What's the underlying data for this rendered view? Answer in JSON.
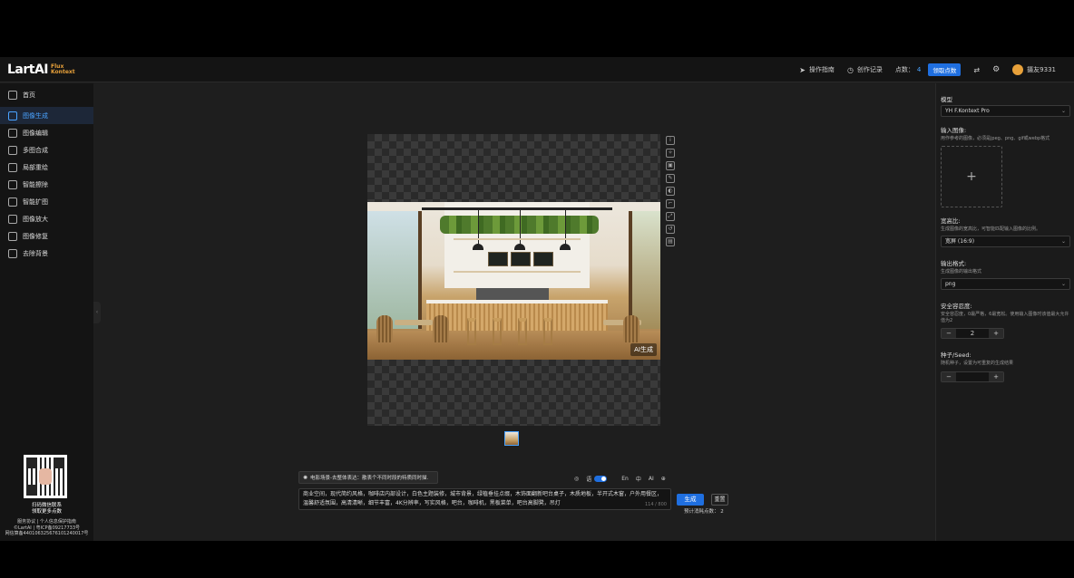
{
  "header": {
    "logo_main": "LartAI",
    "logo_sub_1": "Flux",
    "logo_sub_2": "Kontext",
    "guide": "操作指南",
    "history": "创作记录",
    "points_label": "点数：",
    "points_value": "4",
    "claim_button": "领取点数",
    "username": "摄友9331"
  },
  "sidebar": {
    "home": "首页",
    "items": [
      {
        "label": "图像生成"
      },
      {
        "label": "图像编辑"
      },
      {
        "label": "多图合成"
      },
      {
        "label": "局部重绘"
      },
      {
        "label": "智能擦除"
      },
      {
        "label": "智能扩图"
      },
      {
        "label": "图像放大"
      },
      {
        "label": "图像修复"
      },
      {
        "label": "去除背景"
      }
    ],
    "qr_caption_1": "扫码微信联系",
    "qr_caption_2": "领取更多点数",
    "footer_1": "服务协议 | 个人信息保护指南",
    "footer_2": "©LartAI | 粤ICP备09217733号",
    "footer_3": "网信算备440106325676101240017号"
  },
  "canvas": {
    "watermark": "AI生成"
  },
  "composer": {
    "chip_text": "电影场景-去整体表达：散表个不同时段的特质同时描.",
    "opt_lang": "语",
    "opt_en": "En",
    "opt_zh": "中",
    "opt_ai": "AI",
    "prompt_text": "商业空间，现代简约风格，咖啡店内部设计，白色主题装修，城市背景，绿植垂挂点缀，木饰面翻新吧台桌子，木质地板，半开式木窗，户外用餐区，温馨舒适氛围，高清清晰，细节丰富，4K分辨率，写实风格，吧台，咖啡机，黑板菜单，吧台高脚凳，吊灯",
    "char_count": "114 / 800",
    "generate_button": "生成",
    "reset_button": "重置",
    "cost_label": "预计消耗点数：",
    "cost_value": "2"
  },
  "panel": {
    "model_label": "模型",
    "model_value": "YH F.Kontext Pro",
    "input_label": "输入图像:",
    "input_desc": "用作参考的图像，必须是jpeg、png、gif或webp格式",
    "ratio_label": "宽高比:",
    "ratio_desc": "生成图像的宽高比，可智能匹配输入图像的比例。",
    "ratio_value": "宽屏 (16:9)",
    "format_label": "输出格式:",
    "format_desc": "生成图像的输出格式",
    "format_value": "png",
    "safety_label": "安全容忍度:",
    "safety_desc": "安全容忍度，0最严格，6最宽松。使用输入图像时该值最大允许值为2",
    "safety_value": "2",
    "seed_label": "种子/Seed:",
    "seed_desc": "随机种子，设置为可重复的生成结果",
    "seed_value": ""
  }
}
